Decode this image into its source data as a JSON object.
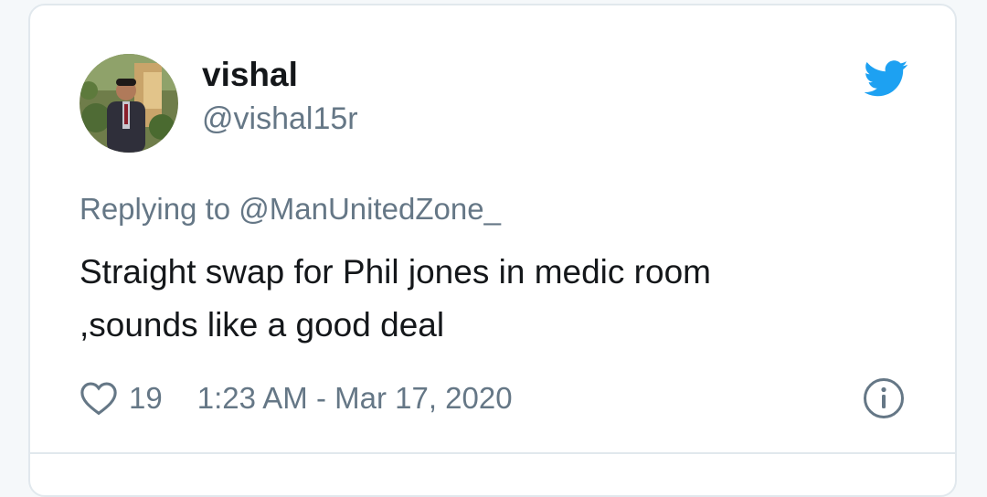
{
  "user": {
    "name": "vishal",
    "handle": "@vishal15r"
  },
  "reply": {
    "prefix": "Replying to ",
    "handle": "@ManUnitedZone_"
  },
  "tweet": {
    "text_line1": "Straight swap for Phil jones in medic room",
    "text_line2": ",sounds like a good deal"
  },
  "footer": {
    "likes": "19",
    "timestamp": "1:23 AM - Mar 17, 2020"
  },
  "colors": {
    "twitter_blue": "#1da1f2",
    "secondary_text": "#657786",
    "primary_text": "#14171a",
    "border": "#e1e8ed"
  },
  "icons": {
    "brand": "twitter-bird-icon",
    "like": "heart-icon",
    "info": "info-icon"
  }
}
